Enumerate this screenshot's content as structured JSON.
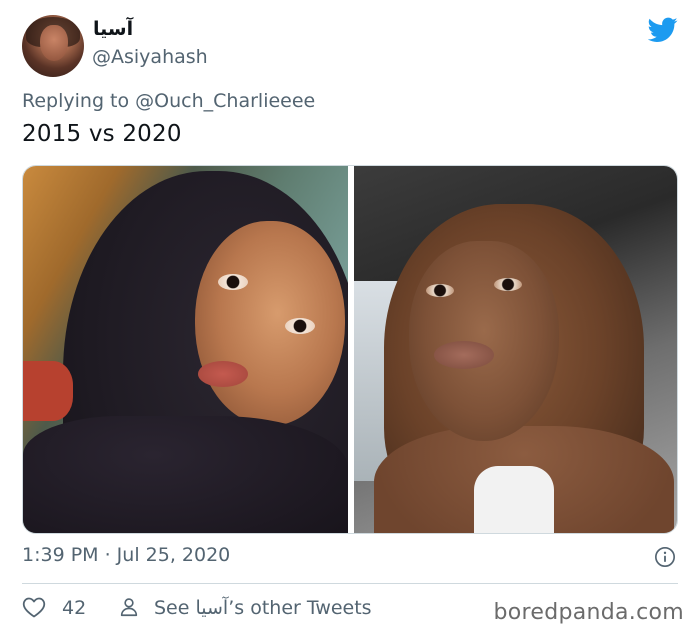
{
  "author": {
    "display_name": "آسيا",
    "handle": "@Asiyahash"
  },
  "reply": {
    "prefix": "Replying to",
    "mention": "@Ouch_Charlieeee"
  },
  "tweet": {
    "text": "2015 vs 2020"
  },
  "meta": {
    "timestamp": "1:39 PM · Jul 25, 2020"
  },
  "actions": {
    "likes": "42",
    "see_other_tweets": "See آسيا’s other Tweets"
  },
  "watermark": "boredpanda.com",
  "colors": {
    "twitter_blue": "#1d9bf0",
    "secondary_text": "#536471",
    "primary_text": "#0f1419",
    "border": "#cfd9de"
  },
  "icons": {
    "brand": "twitter-bird-icon",
    "info": "info-icon",
    "like": "heart-icon",
    "profile": "person-icon"
  }
}
